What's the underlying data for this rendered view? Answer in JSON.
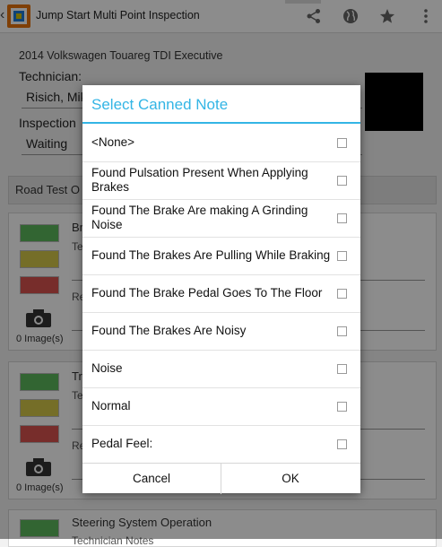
{
  "app": {
    "title": "Jump Start Multi Point Inspection",
    "actions": [
      "share-icon",
      "globe-icon",
      "star-icon",
      "overflow-menu-icon"
    ]
  },
  "form": {
    "vehicle": "2014 Volkswagen Touareg TDI Executive",
    "technician_label": "Technician:",
    "technician_value": "Risich, Mik",
    "inspection_label": "Inspection",
    "inspection_value": "Waiting",
    "section_header": "Road Test O",
    "cards": [
      {
        "title": "Br",
        "sub1": "Te",
        "sub2": "Re",
        "images": "0 Image(s)"
      },
      {
        "title": "Tr",
        "sub1": "Te",
        "sub2": "Re",
        "images": "0 Image(s)"
      },
      {
        "title": "Steering System Operation",
        "sub1": "Technician Notes"
      }
    ]
  },
  "dialog": {
    "title": "Select Canned Note",
    "items": [
      {
        "label": "<None>",
        "checked": false
      },
      {
        "label": "Found Pulsation Present When Applying Brakes",
        "checked": false
      },
      {
        "label": "Found The Brake Are making A Grinding Noise",
        "checked": false
      },
      {
        "label": "Found The Brakes Are Pulling While Braking",
        "checked": false
      },
      {
        "label": "Found The Brake Pedal Goes To The Floor",
        "checked": false
      },
      {
        "label": "Found The Brakes Are Noisy",
        "checked": false
      },
      {
        "label": "Noise",
        "checked": false
      },
      {
        "label": "Normal",
        "checked": false
      },
      {
        "label": "Pedal Feel:",
        "checked": false
      }
    ],
    "cancel": "Cancel",
    "ok": "OK"
  },
  "colors": {
    "accent": "#33b5e5",
    "status_green": "#5cb85c",
    "status_yellow": "#d6c84a",
    "status_red": "#d9534f"
  }
}
